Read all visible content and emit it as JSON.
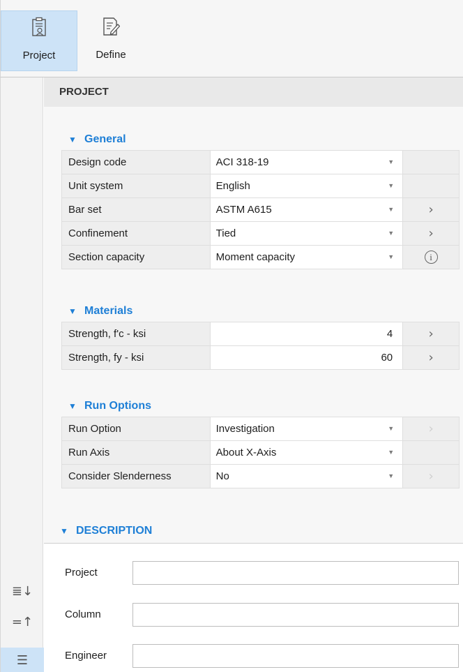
{
  "ribbon": {
    "buttons": [
      {
        "label": "Project",
        "icon": "project-clipboard-icon",
        "active": true
      },
      {
        "label": "Define",
        "icon": "define-edit-icon",
        "active": false
      }
    ]
  },
  "rail": {
    "icons": [
      "sort-descending-icon",
      "collapse-all-icon",
      "list-view-icon"
    ]
  },
  "panel": {
    "title": "PROJECT",
    "groups": {
      "general": {
        "title": "General",
        "rows": [
          {
            "label": "Design code",
            "value": "ACI 318-19"
          },
          {
            "label": "Unit system",
            "value": "English"
          },
          {
            "label": "Bar set",
            "value": "ASTM A615"
          },
          {
            "label": "Confinement",
            "value": "Tied"
          },
          {
            "label": "Section capacity",
            "value": "Moment capacity"
          }
        ]
      },
      "materials": {
        "title": "Materials",
        "rows": [
          {
            "label": "Strength, f'c - ksi",
            "value": "4"
          },
          {
            "label": "Strength, fy  - ksi",
            "value": "60"
          }
        ]
      },
      "run_options": {
        "title": "Run Options",
        "rows": [
          {
            "label": "Run Option",
            "value": "Investigation"
          },
          {
            "label": "Run Axis",
            "value": "About X-Axis"
          },
          {
            "label": "Consider Slenderness",
            "value": "No"
          }
        ]
      }
    },
    "description": {
      "title": "DESCRIPTION",
      "fields": [
        {
          "label": "Project",
          "value": ""
        },
        {
          "label": "Column",
          "value": ""
        },
        {
          "label": "Engineer",
          "value": ""
        }
      ]
    }
  },
  "colors": {
    "accent": "#1e7fd6",
    "active_bg": "#cde3f7",
    "label_bg": "#eeeeee"
  }
}
